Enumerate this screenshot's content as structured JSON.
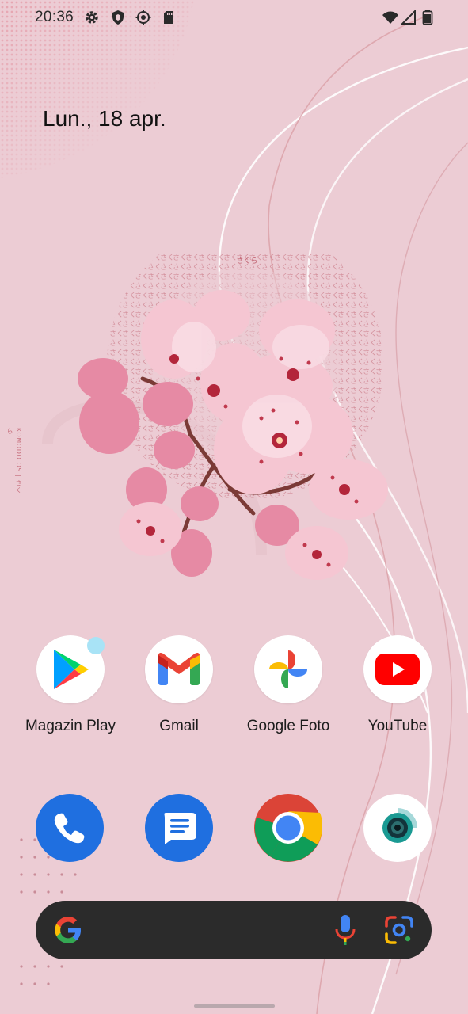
{
  "status_bar": {
    "time": "20:36",
    "left_icons": [
      "gear-icon",
      "shield-icon",
      "sync-icon",
      "sd-card-icon"
    ],
    "right_icons": [
      "wifi-icon",
      "signal-icon",
      "battery-icon"
    ]
  },
  "home": {
    "date": "Lun., 18 apr.",
    "wallpaper_side_text": "KOMODO OS | さくら",
    "wallpaper_pattern_text": "さくら"
  },
  "apps": [
    {
      "label": "Magazin Play",
      "icon": "play-store-icon",
      "has_badge": true
    },
    {
      "label": "Gmail",
      "icon": "gmail-icon",
      "has_badge": false
    },
    {
      "label": "Google Foto",
      "icon": "google-photos-icon",
      "has_badge": false
    },
    {
      "label": "YouTube",
      "icon": "youtube-icon",
      "has_badge": false
    }
  ],
  "dock": [
    {
      "name": "phone",
      "icon": "phone-icon"
    },
    {
      "name": "messages",
      "icon": "messages-icon"
    },
    {
      "name": "chrome",
      "icon": "chrome-icon"
    },
    {
      "name": "camera",
      "icon": "camera-icon"
    }
  ],
  "search_bar": {
    "left_icon": "google-g-icon",
    "right_icons": [
      "mic-icon",
      "lens-icon"
    ]
  },
  "colors": {
    "background": "#ecccd4",
    "search_bar": "#2b2b2b",
    "badge": "#a8e3f6",
    "dock_blue": "#2a6fdb"
  }
}
